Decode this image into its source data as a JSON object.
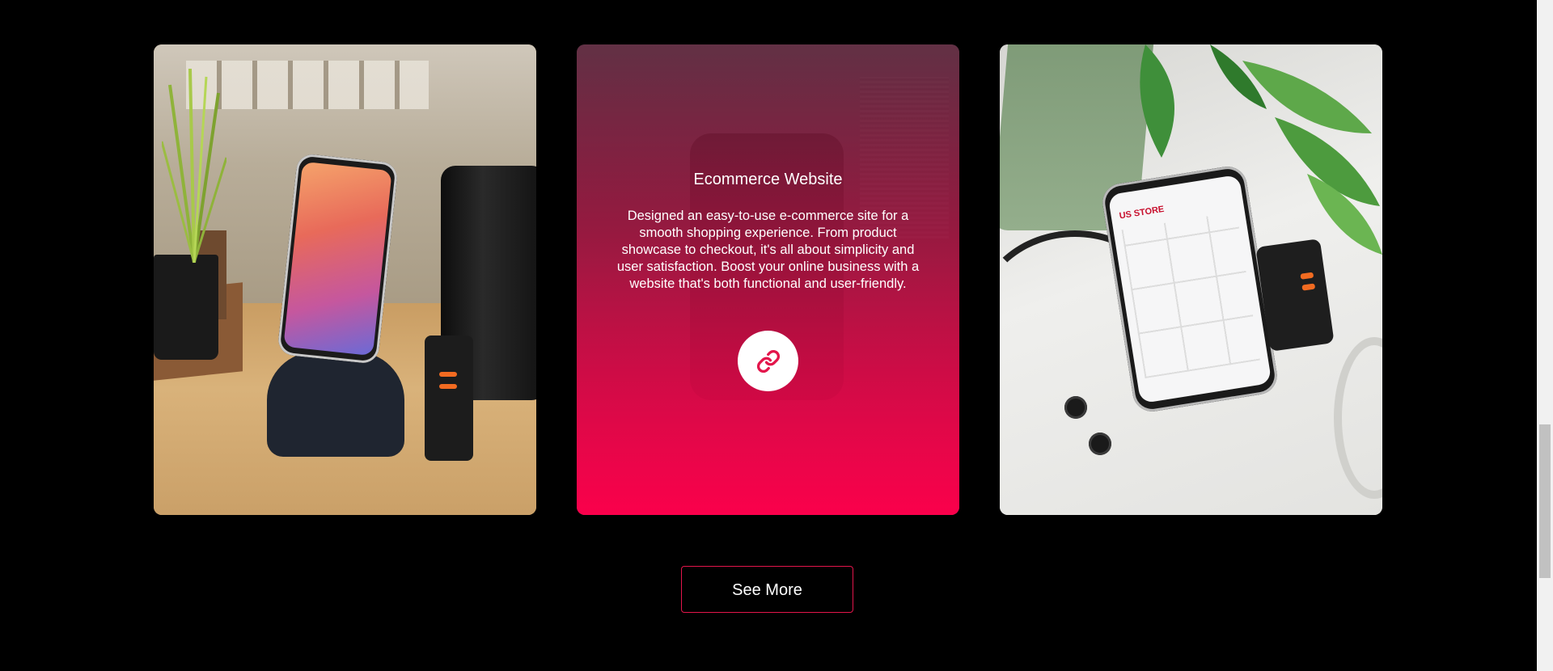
{
  "portfolio": {
    "cards": [
      {
        "image_alt": "Phone on stand with charger",
        "icon": "phone-stand-photo"
      },
      {
        "title": "Ecommerce Website",
        "description": "Designed an easy-to-use e-commerce site for a smooth shopping experience. From product showcase to checkout, it's all about simplicity and user satisfaction. Boost your online business with a website that's both functional and user-friendly.",
        "link_icon": "link-icon"
      },
      {
        "image_alt": "Phone showing US STORE website with earbuds and charger",
        "icon": "phone-store-photo",
        "screen_brand": "US STORE"
      }
    ],
    "see_more_label": "See More"
  },
  "colors": {
    "accent": "#ff0050",
    "button_border": "#e3154b",
    "background": "#000000"
  }
}
